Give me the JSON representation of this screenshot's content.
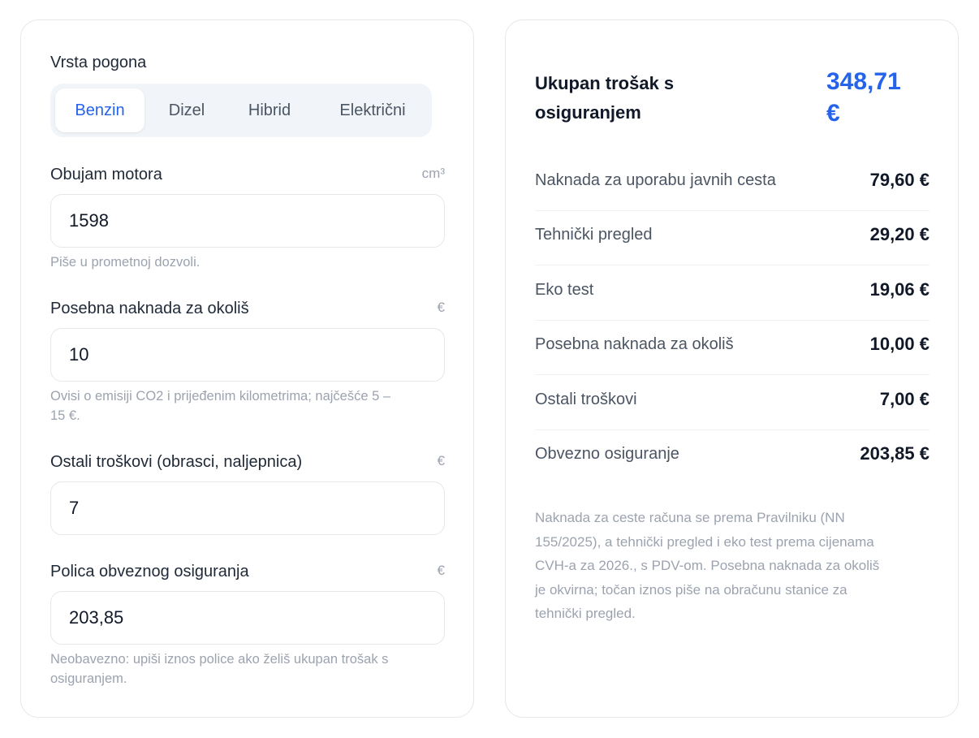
{
  "form": {
    "drive_type": {
      "label": "Vrsta pogona",
      "options": [
        "Benzin",
        "Dizel",
        "Hibrid",
        "Električni"
      ],
      "selected": "Benzin"
    },
    "engine": {
      "label": "Obujam motora",
      "unit": "cm³",
      "value": "1598",
      "hint": "Piše u prometnoj dozvoli."
    },
    "env_fee": {
      "label": "Posebna naknada za okoliš",
      "unit": "€",
      "value": "10",
      "hint_line1": "Ovisi o emisiji CO2 i prijeđenim kilometrima; najčešće 5 –",
      "hint_line2": "15 €."
    },
    "other": {
      "label": "Ostali troškovi (obrasci, naljepnica)",
      "unit": "€",
      "value": "7"
    },
    "insurance": {
      "label": "Polica obveznog osiguranja",
      "unit": "€",
      "value": "203,85",
      "hint_line1": "Neobavezno: upiši iznos police ako želiš ukupan trošak s",
      "hint_line2": "osiguranjem."
    }
  },
  "summary": {
    "total_label_line1": "Ukupan trošak s",
    "total_label_line2": "osiguranjem",
    "total_value_line1": "348,71",
    "total_value_line2": "€",
    "rows": [
      {
        "label": "Naknada za uporabu javnih cesta",
        "value": "79,60 €"
      },
      {
        "label": "Tehnički pregled",
        "value": "29,20 €"
      },
      {
        "label": "Eko test",
        "value": "19,06 €"
      },
      {
        "label": "Posebna naknada za okoliš",
        "value": "10,00 €"
      },
      {
        "label": "Ostali troškovi",
        "value": "7,00 €"
      },
      {
        "label": "Obvezno osiguranje",
        "value": "203,85 €"
      }
    ],
    "note_lines": [
      "Naknada za ceste računa se prema Pravilniku (NN",
      "155/2025), a tehnički pregled i eko test prema cijenama",
      "CVH-a za 2026., s PDV-om. Posebna naknada za okoliš",
      "je okvirna; točan iznos piše na obračunu stanice za",
      "tehnički pregled."
    ]
  },
  "colors": {
    "accent": "#2563eb",
    "border": "#e5e7eb",
    "muted": "#9ca3af"
  }
}
